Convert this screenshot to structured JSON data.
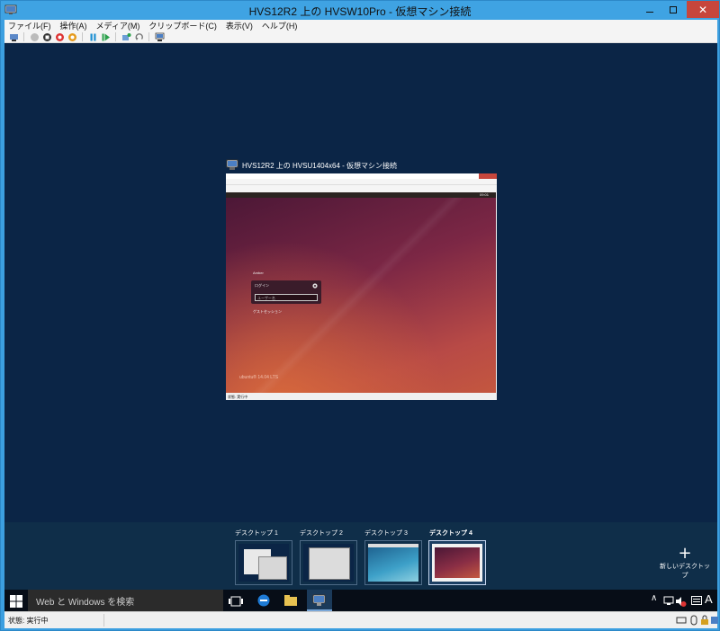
{
  "window": {
    "title": "HVS12R2 上の HVSW10Pro  - 仮想マシン接続"
  },
  "menu": [
    "ファイル(F)",
    "操作(A)",
    "メディア(M)",
    "クリップボード(C)",
    "表示(V)",
    "ヘルプ(H)"
  ],
  "toolbar_icons": [
    "ctrl-alt-del-icon",
    "start-icon",
    "turn-off-icon",
    "shutdown-icon",
    "save-icon",
    "pause-icon",
    "reset-icon",
    "checkpoint-icon",
    "revert-icon",
    "enhanced-session-icon"
  ],
  "inner_vm": {
    "title": "HVS12R2 上の HVSU1404x64  - 仮想マシン接続",
    "topbar_time": "09:01",
    "login": {
      "user": "Amber",
      "login_label": "ログイン",
      "password_placeholder": "ユーザー名",
      "guest_label": "ゲストセッション"
    },
    "brand": "ubuntu® 14.04 LTS",
    "status": "状態: 実行中"
  },
  "task_view": {
    "desktops": [
      "デスクトップ 1",
      "デスクトップ 2",
      "デスクトップ 3",
      "デスクトップ 4"
    ],
    "active_index": 3,
    "new_desktop_label": "新しいデスクトップ"
  },
  "taskbar": {
    "search_placeholder": "Web と Windows を検索",
    "ime": "A"
  },
  "status": {
    "text": "状態: 実行中"
  },
  "colors": {
    "desktop": "#0b2546",
    "titlebar": "#3fa3e3",
    "close": "#c7463c",
    "accent": "#37a0dd"
  }
}
